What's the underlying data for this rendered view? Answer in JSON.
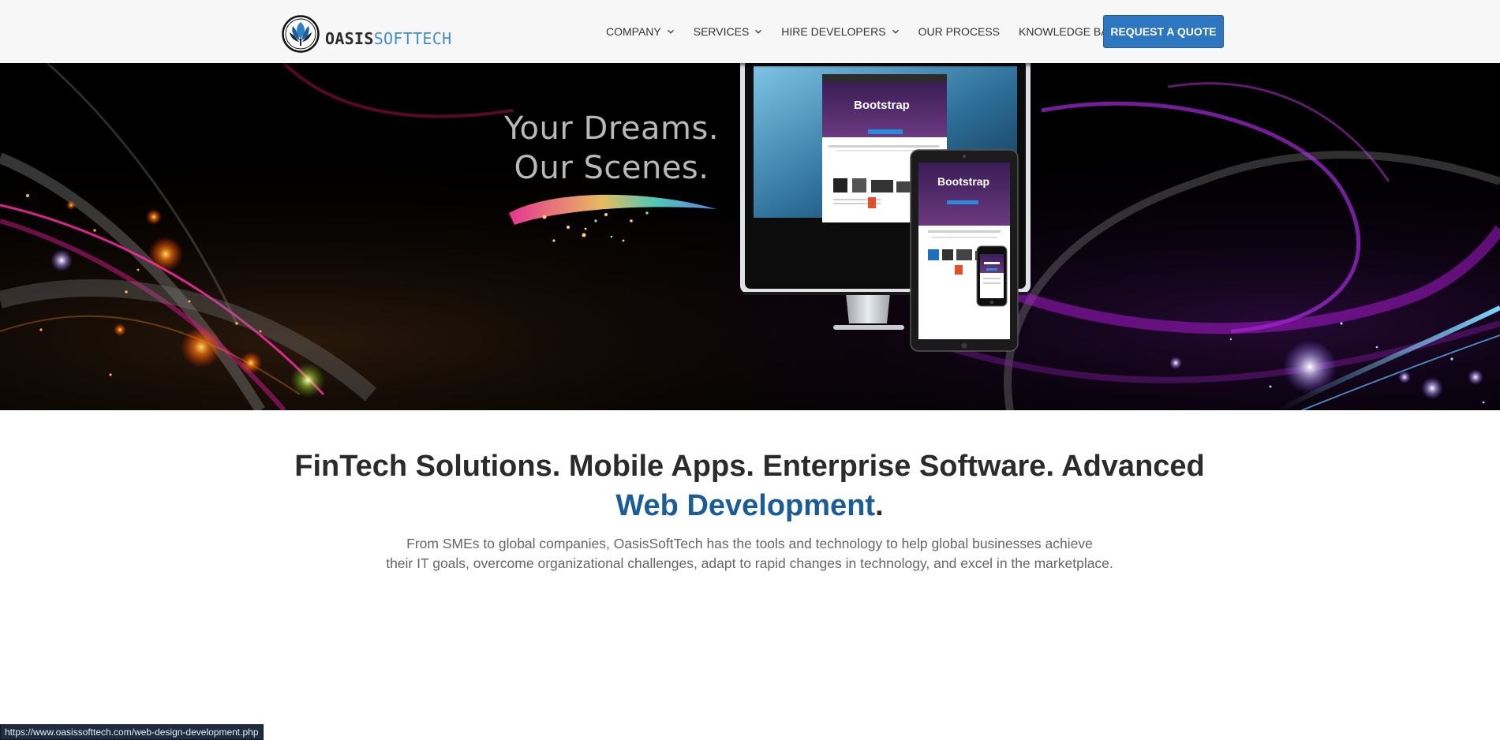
{
  "brand": {
    "name_part1": "OASIS",
    "name_part2": "SOFTTECH",
    "primary_color": "#2c77c0",
    "accent_color": "#1a5b9a",
    "logo_icon": "leaf-logo-icon"
  },
  "nav": {
    "items": [
      {
        "label": "COMPANY",
        "dropdown": true
      },
      {
        "label": "SERVICES",
        "dropdown": true
      },
      {
        "label": "HIRE DEVELOPERS",
        "dropdown": true
      },
      {
        "label": "OUR PROCESS",
        "dropdown": false
      },
      {
        "label": "KNOWLEDGE BASE",
        "dropdown": false
      }
    ],
    "cta_label": "REQUEST A QUOTE"
  },
  "hero": {
    "tagline_line1": "Your Dreams.",
    "tagline_line2": "Our Scenes.",
    "device_brand": "Bootstrap",
    "device_desc": "Sleek, intuitive, responsive and powerful front-end framework for concepts.",
    "device_caption": "Designed for everyone, everywhere."
  },
  "main": {
    "headline_text": "FinTech Solutions. Mobile Apps. Enterprise Software. Advanced ",
    "headline_accent": "Web Development",
    "headline_end": ".",
    "subtext_line1": "From SMEs to global companies, OasisSoftTech has the tools and technology to help global businesses achieve",
    "subtext_line2": "their IT goals, overcome organizational challenges, adapt to rapid changes in technology, and excel in the marketplace."
  },
  "status_bar": {
    "url": "https://www.oasissofttech.com/web-design-development.php"
  }
}
